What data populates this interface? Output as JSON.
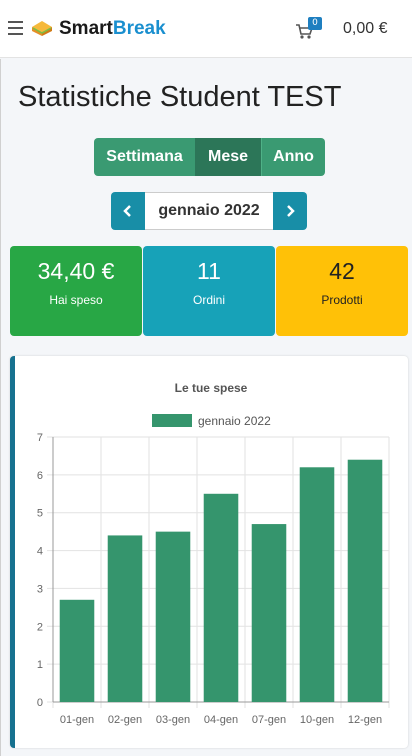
{
  "header": {
    "logo_part1": "Smart",
    "logo_part2": "Break",
    "cart_count": "0",
    "cart_total": "0,00 €"
  },
  "page": {
    "title": "Statistiche Student TEST"
  },
  "period_tabs": [
    {
      "label": "Settimana",
      "active": false
    },
    {
      "label": "Mese",
      "active": true
    },
    {
      "label": "Anno",
      "active": false
    }
  ],
  "date_nav": {
    "label": "gennaio 2022"
  },
  "stats": [
    {
      "value": "34,40 €",
      "label": "Hai speso",
      "color": "#28a745"
    },
    {
      "value": "11",
      "label": "Ordini",
      "color": "#17a2b8"
    },
    {
      "value": "42",
      "label": "Prodotti",
      "color": "#ffc107"
    }
  ],
  "colors": {
    "primary_green": "#3a9a72",
    "active_green": "#2c7658",
    "teal": "#188ea7",
    "bar": "#35956d"
  },
  "chart_data": {
    "type": "bar",
    "title": "Le tue spese",
    "categories": [
      "01-gen",
      "02-gen",
      "03-gen",
      "04-gen",
      "07-gen",
      "10-gen",
      "12-gen"
    ],
    "series": [
      {
        "name": "gennaio 2022",
        "values": [
          2.7,
          4.4,
          4.5,
          5.5,
          4.7,
          6.2,
          6.4
        ]
      }
    ],
    "ylim": [
      0,
      7
    ],
    "yticks": [
      "0",
      "1",
      "2",
      "3",
      "4",
      "5",
      "6",
      "7"
    ],
    "grid": true,
    "legend": "top-center"
  }
}
